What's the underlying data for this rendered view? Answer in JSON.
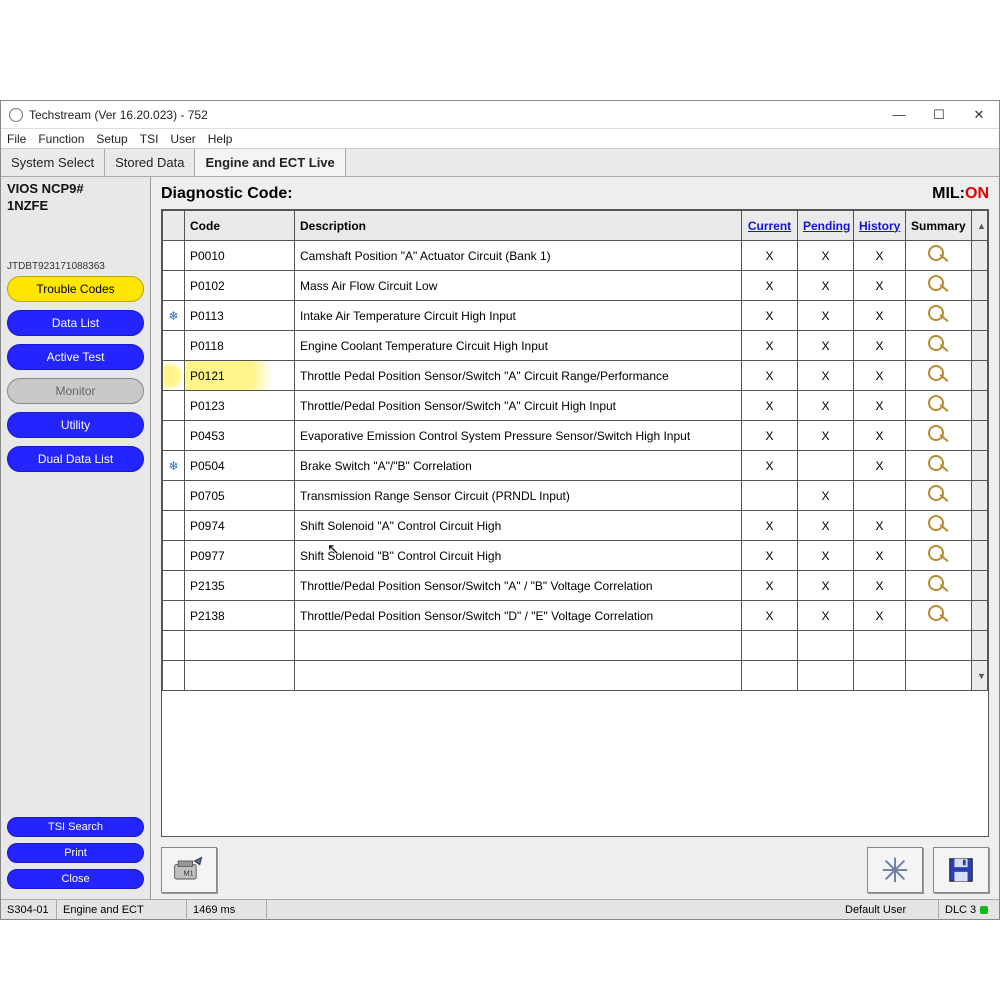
{
  "window": {
    "title": "Techstream (Ver 16.20.023) - 752"
  },
  "menu": {
    "items": [
      "File",
      "Function",
      "Setup",
      "TSI",
      "User",
      "Help"
    ]
  },
  "tabs": [
    {
      "label": "System Select",
      "active": false
    },
    {
      "label": "Stored Data",
      "active": false
    },
    {
      "label": "Engine and ECT Live",
      "active": true
    }
  ],
  "sidebar": {
    "vehicle_line1": "VIOS NCP9#",
    "vehicle_line2": "1NZFE",
    "vin": "JTDBT923171088363",
    "nav": [
      {
        "label": "Trouble Codes",
        "style": "yellow"
      },
      {
        "label": "Data List",
        "style": "blue"
      },
      {
        "label": "Active Test",
        "style": "blue"
      },
      {
        "label": "Monitor",
        "style": "grey"
      },
      {
        "label": "Utility",
        "style": "blue"
      },
      {
        "label": "Dual Data List",
        "style": "blue"
      }
    ],
    "bottom": [
      {
        "label": "TSI Search"
      },
      {
        "label": "Print"
      },
      {
        "label": "Close"
      }
    ]
  },
  "main": {
    "title": "Diagnostic Code:",
    "mil_label": "MIL:",
    "mil_value": "ON",
    "columns": {
      "code": "Code",
      "description": "Description",
      "current": "Current",
      "pending": "Pending",
      "history": "History",
      "summary": "Summary"
    },
    "rows": [
      {
        "flag": "",
        "code": "P0010",
        "desc": "Camshaft Position \"A\" Actuator Circuit (Bank 1)",
        "cur": "X",
        "pen": "X",
        "his": "X",
        "sum": true
      },
      {
        "flag": "",
        "code": "P0102",
        "desc": "Mass Air Flow Circuit Low",
        "cur": "X",
        "pen": "X",
        "his": "X",
        "sum": true
      },
      {
        "flag": "❄",
        "code": "P0113",
        "desc": "Intake Air Temperature Circuit High Input",
        "cur": "X",
        "pen": "X",
        "his": "X",
        "sum": true
      },
      {
        "flag": "",
        "code": "P0118",
        "desc": "Engine Coolant Temperature Circuit High Input",
        "cur": "X",
        "pen": "X",
        "his": "X",
        "sum": true
      },
      {
        "flag": "",
        "code": "P0121",
        "desc": "Throttle Pedal Position Sensor/Switch \"A\" Circuit Range/Performance",
        "cur": "X",
        "pen": "X",
        "his": "X",
        "sum": true,
        "highlight": true
      },
      {
        "flag": "",
        "code": "P0123",
        "desc": "Throttle/Pedal Position Sensor/Switch \"A\" Circuit High Input",
        "cur": "X",
        "pen": "X",
        "his": "X",
        "sum": true
      },
      {
        "flag": "",
        "code": "P0453",
        "desc": "Evaporative Emission Control System Pressure Sensor/Switch High Input",
        "cur": "X",
        "pen": "X",
        "his": "X",
        "sum": true
      },
      {
        "flag": "❄",
        "code": "P0504",
        "desc": "Brake Switch \"A\"/\"B\" Correlation",
        "cur": "X",
        "pen": "",
        "his": "X",
        "sum": true
      },
      {
        "flag": "",
        "code": "P0705",
        "desc": "Transmission Range Sensor Circuit (PRNDL Input)",
        "cur": "",
        "pen": "X",
        "his": "",
        "sum": true
      },
      {
        "flag": "",
        "code": "P0974",
        "desc": "Shift Solenoid \"A\" Control Circuit High",
        "cur": "X",
        "pen": "X",
        "his": "X",
        "sum": true
      },
      {
        "flag": "",
        "code": "P0977",
        "desc": "Shift Solenoid \"B\" Control Circuit High",
        "cur": "X",
        "pen": "X",
        "his": "X",
        "sum": true
      },
      {
        "flag": "",
        "code": "P2135",
        "desc": "Throttle/Pedal Position Sensor/Switch \"A\" / \"B\" Voltage Correlation",
        "cur": "X",
        "pen": "X",
        "his": "X",
        "sum": true
      },
      {
        "flag": "",
        "code": "P2138",
        "desc": "Throttle/Pedal Position Sensor/Switch \"D\" / \"E\" Voltage Correlation",
        "cur": "X",
        "pen": "X",
        "his": "X",
        "sum": true
      },
      {
        "flag": "",
        "code": "",
        "desc": "",
        "cur": "",
        "pen": "",
        "his": "",
        "sum": false
      },
      {
        "flag": "",
        "code": "",
        "desc": "",
        "cur": "",
        "pen": "",
        "his": "",
        "sum": false
      }
    ]
  },
  "status": {
    "left1": "S304-01",
    "left2": "Engine and ECT",
    "ms": "1469 ms",
    "user": "Default User",
    "dlc": "DLC 3"
  }
}
